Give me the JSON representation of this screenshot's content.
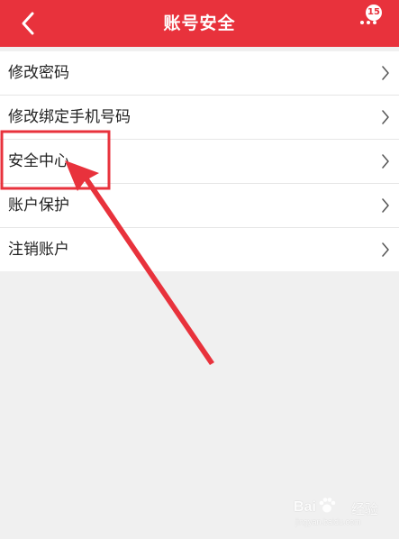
{
  "header": {
    "title": "账号安全",
    "badge_count": "15",
    "back_icon": "chevron-left-icon",
    "more_icon": "more-dots-icon",
    "background_color": "#e8323c"
  },
  "menu": {
    "items": [
      {
        "label": "修改密码"
      },
      {
        "label": "修改绑定手机号码"
      },
      {
        "label": "安全中心"
      },
      {
        "label": "账户保护"
      },
      {
        "label": "注销账户"
      }
    ]
  },
  "annotation": {
    "highlighted_item": "安全中心",
    "color": "#e8323c"
  },
  "watermark": {
    "text": "Bai",
    "text_suffix": "经验",
    "url": "jingyan.baidu.com"
  }
}
